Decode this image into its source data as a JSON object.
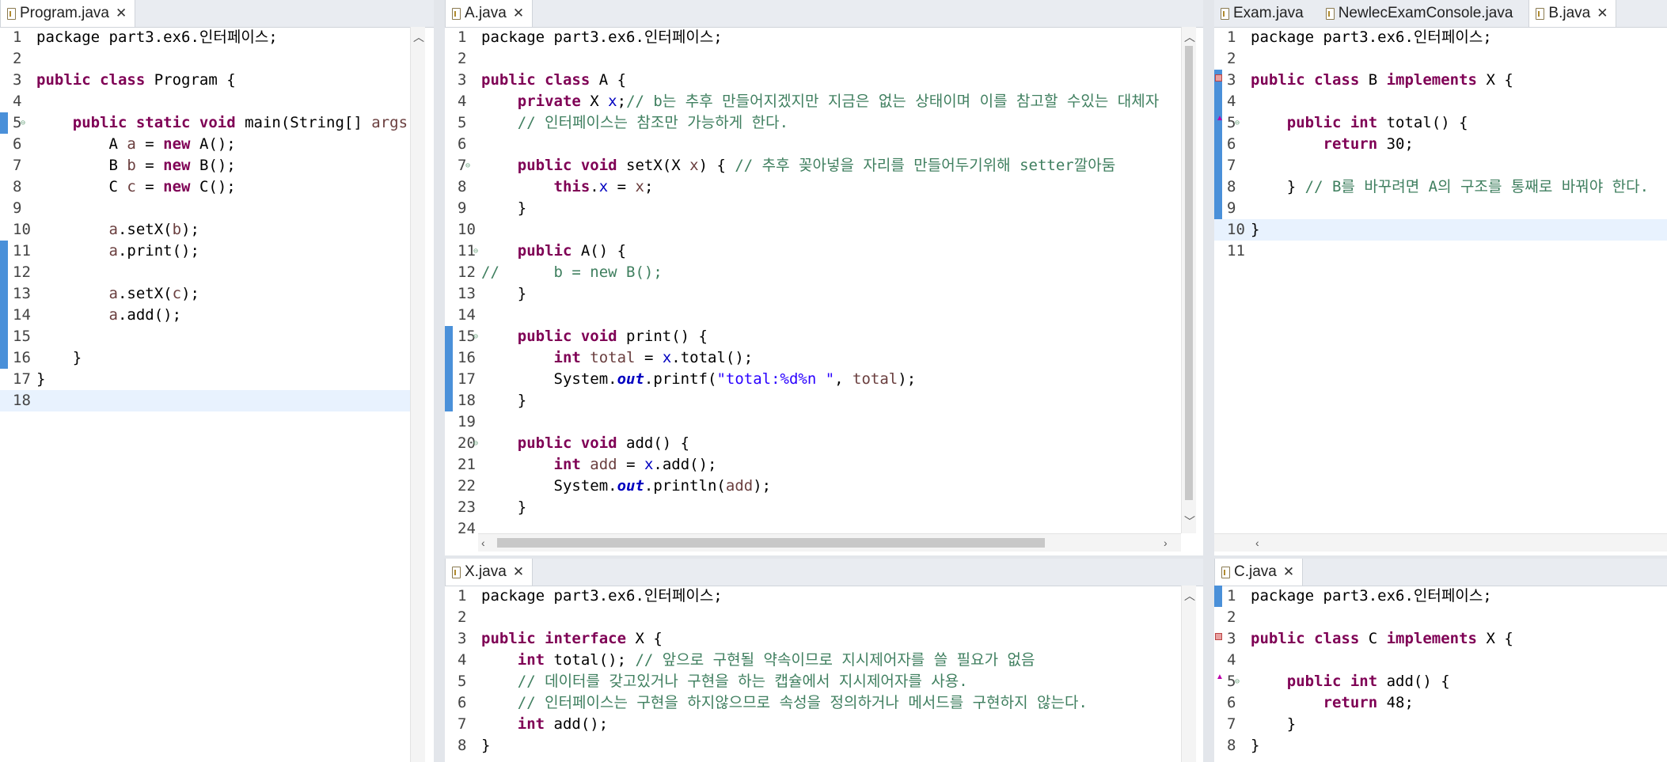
{
  "panes": {
    "program": {
      "tabs": [
        {
          "label": "Program.java",
          "active": true,
          "closable": true
        }
      ],
      "lines": [
        [
          {
            "t": "package part3.ex6.인터페이스;"
          }
        ],
        [],
        [
          {
            "t": "public class",
            "c": "kw"
          },
          {
            "t": " Program {"
          }
        ],
        [],
        [
          {
            "t": "    "
          },
          {
            "t": "public static void",
            "c": "kw"
          },
          {
            "t": " main(String[] "
          },
          {
            "t": "args",
            "c": "lv"
          }
        ],
        [
          {
            "t": "        A "
          },
          {
            "t": "a",
            "c": "lv"
          },
          {
            "t": " = "
          },
          {
            "t": "new",
            "c": "kw"
          },
          {
            "t": " A();"
          }
        ],
        [
          {
            "t": "        B "
          },
          {
            "t": "b",
            "c": "lv"
          },
          {
            "t": " = "
          },
          {
            "t": "new",
            "c": "kw"
          },
          {
            "t": " B();"
          }
        ],
        [
          {
            "t": "        C "
          },
          {
            "t": "c",
            "c": "lv"
          },
          {
            "t": " = "
          },
          {
            "t": "new",
            "c": "kw"
          },
          {
            "t": " C();"
          }
        ],
        [],
        [
          {
            "t": "        "
          },
          {
            "t": "a",
            "c": "lv"
          },
          {
            "t": ".setX("
          },
          {
            "t": "b",
            "c": "lv"
          },
          {
            "t": ");"
          }
        ],
        [
          {
            "t": "        "
          },
          {
            "t": "a",
            "c": "lv"
          },
          {
            "t": ".print();"
          }
        ],
        [],
        [
          {
            "t": "        "
          },
          {
            "t": "a",
            "c": "lv"
          },
          {
            "t": ".setX("
          },
          {
            "t": "c",
            "c": "lv"
          },
          {
            "t": ");"
          }
        ],
        [
          {
            "t": "        "
          },
          {
            "t": "a",
            "c": "lv"
          },
          {
            "t": ".add();"
          }
        ],
        [],
        [
          {
            "t": "    }"
          }
        ],
        [
          {
            "t": "}"
          }
        ],
        []
      ]
    },
    "a": {
      "tabs": [
        {
          "label": "A.java",
          "active": true,
          "closable": true
        }
      ],
      "lines": [
        [
          {
            "t": "package part3.ex6.인터페이스;"
          }
        ],
        [],
        [
          {
            "t": "public class",
            "c": "kw"
          },
          {
            "t": " A {"
          }
        ],
        [
          {
            "t": "    "
          },
          {
            "t": "private",
            "c": "kw"
          },
          {
            "t": " X "
          },
          {
            "t": "x",
            "c": "fd"
          },
          {
            "t": ";"
          },
          {
            "t": "// b는 추후 만들어지겠지만 지금은 없는 상태이며 이를 참고할 수있는 대체자",
            "c": "cm"
          }
        ],
        [
          {
            "t": "    "
          },
          {
            "t": "// 인터페이스는 참조만 가능하게 한다.",
            "c": "cm"
          }
        ],
        [],
        [
          {
            "t": "    "
          },
          {
            "t": "public void",
            "c": "kw"
          },
          {
            "t": " setX(X "
          },
          {
            "t": "x",
            "c": "lv"
          },
          {
            "t": ") { "
          },
          {
            "t": "// 추후 꽂아넣을 자리를 만들어두기위해 setter깔아둠",
            "c": "cm"
          }
        ],
        [
          {
            "t": "        "
          },
          {
            "t": "this",
            "c": "kw"
          },
          {
            "t": "."
          },
          {
            "t": "x",
            "c": "fd"
          },
          {
            "t": " = "
          },
          {
            "t": "x",
            "c": "lv"
          },
          {
            "t": ";"
          }
        ],
        [
          {
            "t": "    }"
          }
        ],
        [],
        [
          {
            "t": "    "
          },
          {
            "t": "public",
            "c": "kw"
          },
          {
            "t": " A() {"
          }
        ],
        [
          {
            "t": "//      b = new B();",
            "c": "cm"
          }
        ],
        [
          {
            "t": "    }"
          }
        ],
        [],
        [
          {
            "t": "    "
          },
          {
            "t": "public void",
            "c": "kw"
          },
          {
            "t": " print() {"
          }
        ],
        [
          {
            "t": "        "
          },
          {
            "t": "int",
            "c": "kw"
          },
          {
            "t": " "
          },
          {
            "t": "total",
            "c": "lv"
          },
          {
            "t": " = "
          },
          {
            "t": "x",
            "c": "fd"
          },
          {
            "t": ".total();"
          }
        ],
        [
          {
            "t": "        System."
          },
          {
            "t": "out",
            "c": "fs"
          },
          {
            "t": ".printf("
          },
          {
            "t": "\"total:%d%n \"",
            "c": "st"
          },
          {
            "t": ", "
          },
          {
            "t": "total",
            "c": "lv"
          },
          {
            "t": ");"
          }
        ],
        [
          {
            "t": "    }"
          }
        ],
        [],
        [
          {
            "t": "    "
          },
          {
            "t": "public void",
            "c": "kw"
          },
          {
            "t": " add() {"
          }
        ],
        [
          {
            "t": "        "
          },
          {
            "t": "int",
            "c": "kw"
          },
          {
            "t": " "
          },
          {
            "t": "add",
            "c": "lv"
          },
          {
            "t": " = "
          },
          {
            "t": "x",
            "c": "fd"
          },
          {
            "t": ".add();"
          }
        ],
        [
          {
            "t": "        System."
          },
          {
            "t": "out",
            "c": "fs"
          },
          {
            "t": ".println("
          },
          {
            "t": "add",
            "c": "lv"
          },
          {
            "t": ");"
          }
        ],
        [
          {
            "t": "    }"
          }
        ],
        []
      ]
    },
    "b": {
      "tabs": [
        {
          "label": "Exam.java",
          "active": false,
          "closable": false
        },
        {
          "label": "NewlecExamConsole.java",
          "active": false,
          "closable": false
        },
        {
          "label": "B.java",
          "active": true,
          "closable": true
        }
      ],
      "lines": [
        [
          {
            "t": "package part3.ex6.인터페이스;"
          }
        ],
        [],
        [
          {
            "t": "public class",
            "c": "kw"
          },
          {
            "t": " B "
          },
          {
            "t": "implements",
            "c": "kw"
          },
          {
            "t": " X {"
          }
        ],
        [],
        [
          {
            "t": "    "
          },
          {
            "t": "public int",
            "c": "kw"
          },
          {
            "t": " total() {"
          }
        ],
        [
          {
            "t": "        "
          },
          {
            "t": "return",
            "c": "kw"
          },
          {
            "t": " 30;"
          }
        ],
        [],
        [
          {
            "t": "    } "
          },
          {
            "t": "// B를 바꾸려면 A의 구조를 통째로 바꿔야 한다.",
            "c": "cm"
          }
        ],
        [],
        [
          {
            "t": "}"
          }
        ],
        []
      ]
    },
    "x": {
      "tabs": [
        {
          "label": "X.java",
          "active": true,
          "closable": true
        }
      ],
      "lines": [
        [
          {
            "t": "package part3.ex6.인터페이스;"
          }
        ],
        [],
        [
          {
            "t": "public interface",
            "c": "kw"
          },
          {
            "t": " X {"
          }
        ],
        [
          {
            "t": "    "
          },
          {
            "t": "int",
            "c": "kw"
          },
          {
            "t": " total(); "
          },
          {
            "t": "// 앞으로 구현될 약속이므로 지시제어자를 쓸 필요가 없음",
            "c": "cm"
          }
        ],
        [
          {
            "t": "    "
          },
          {
            "t": "// 데이터를 갖고있거나 구현을 하는 캡슐에서 지시제어자를 사용.",
            "c": "cm"
          }
        ],
        [
          {
            "t": "    "
          },
          {
            "t": "// 인터페이스는 구현을 하지않으므로 속성을 정의하거나 메서드를 구현하지 않는다.",
            "c": "cm"
          }
        ],
        [
          {
            "t": "    "
          },
          {
            "t": "int",
            "c": "kw"
          },
          {
            "t": " add();"
          }
        ],
        [
          {
            "t": "}"
          }
        ]
      ]
    },
    "c": {
      "tabs": [
        {
          "label": "C.java",
          "active": true,
          "closable": true
        }
      ],
      "lines": [
        [
          {
            "t": "package part3.ex6.인터페이스;"
          }
        ],
        [],
        [
          {
            "t": "public class",
            "c": "kw"
          },
          {
            "t": " C "
          },
          {
            "t": "implements",
            "c": "kw"
          },
          {
            "t": " X {"
          }
        ],
        [],
        [
          {
            "t": "    "
          },
          {
            "t": "public int",
            "c": "kw"
          },
          {
            "t": " add() {"
          }
        ],
        [
          {
            "t": "        "
          },
          {
            "t": "return",
            "c": "kw"
          },
          {
            "t": " 48;"
          }
        ],
        [
          {
            "t": "    }"
          }
        ],
        [
          {
            "t": "}"
          }
        ]
      ]
    }
  },
  "icons": {
    "file": "java-file-icon",
    "close": "close-icon",
    "close_glyph": "✕"
  },
  "colors": {
    "keyword": "#7f0055",
    "comment": "#3f7f5f",
    "string": "#2a00ff",
    "field": "#0000c0",
    "local": "#6a3e3e"
  }
}
